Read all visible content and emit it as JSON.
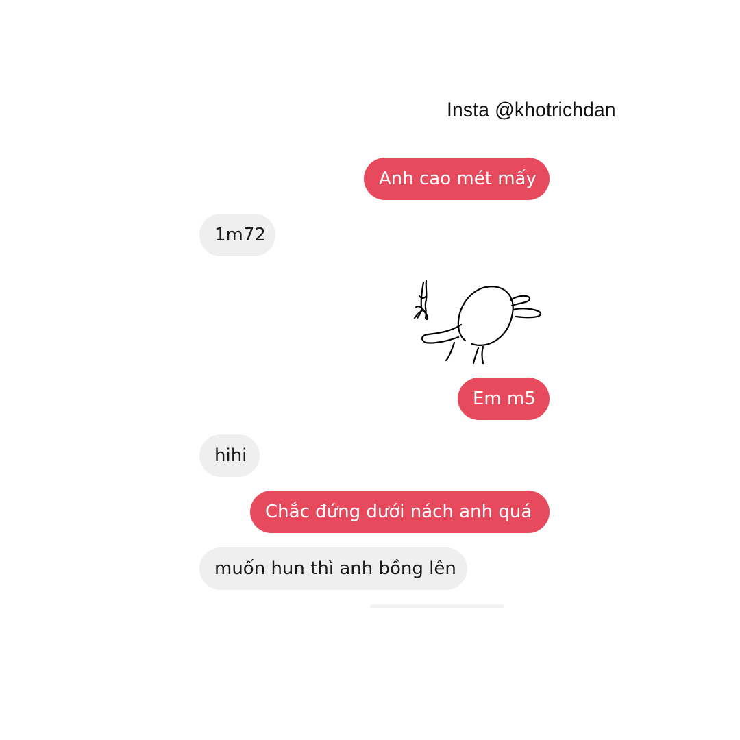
{
  "watermark": "Insta @khotrichdan",
  "colors": {
    "sent_bubble": "#e64a5c",
    "received_bubble": "#efefef",
    "background": "#ffffff"
  },
  "messages": [
    {
      "side": "sent",
      "text": "Anh cao mét mấy"
    },
    {
      "side": "received",
      "text": "1m72"
    },
    {
      "side": "sent",
      "type": "sticker",
      "icon": "bunny-kiss-sticker"
    },
    {
      "side": "sent",
      "text": "Em m5"
    },
    {
      "side": "received",
      "text": "hihi"
    },
    {
      "side": "sent",
      "text": "Chắc đứng dưới nách anh quá"
    },
    {
      "side": "received",
      "text": "muốn hun thì anh bồng lên"
    }
  ]
}
